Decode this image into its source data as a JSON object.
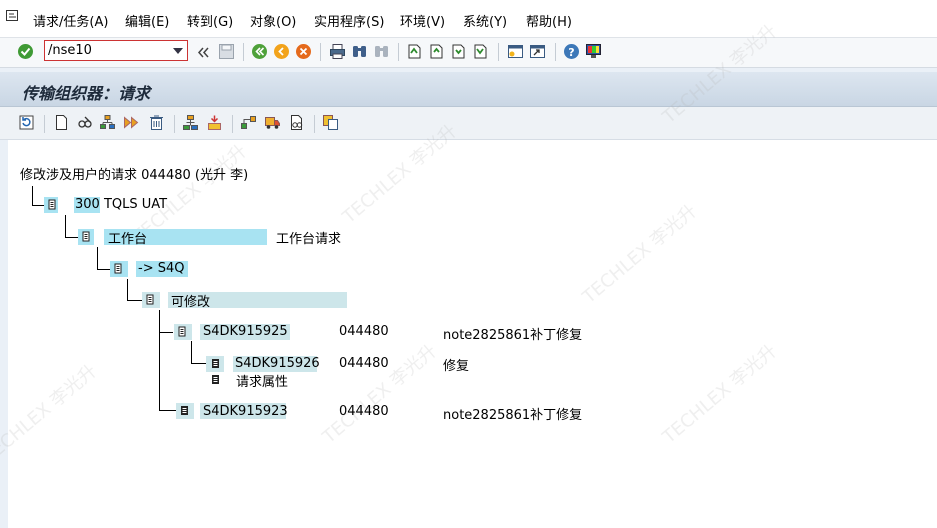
{
  "menu": [
    "请求/任务(A)",
    "编辑(E)",
    "转到(G)",
    "对象(O)",
    "实用程序(S)",
    "环境(V)",
    "系统(Y)",
    "帮助(H)"
  ],
  "command": {
    "value": "/nse10"
  },
  "page_title": "传输组织器：请求",
  "tree": {
    "root": "修改涉及用户的请求 044480 (光升 李)",
    "client": "300 TQLS UAT",
    "category": "工作台",
    "category_desc": "工作台请求",
    "target": "-> S4Q",
    "status": "可修改",
    "req1": {
      "id": "S4DK915925",
      "owner": "044480",
      "desc": "note2825861补丁修复"
    },
    "task1": {
      "id": "S4DK915926",
      "owner": "044480",
      "desc": "修复"
    },
    "attr": "请求属性",
    "req2": {
      "id": "S4DK915923",
      "owner": "044480",
      "desc": "note2825861补丁修复"
    }
  },
  "watermark": "TECHLEX  李光升"
}
